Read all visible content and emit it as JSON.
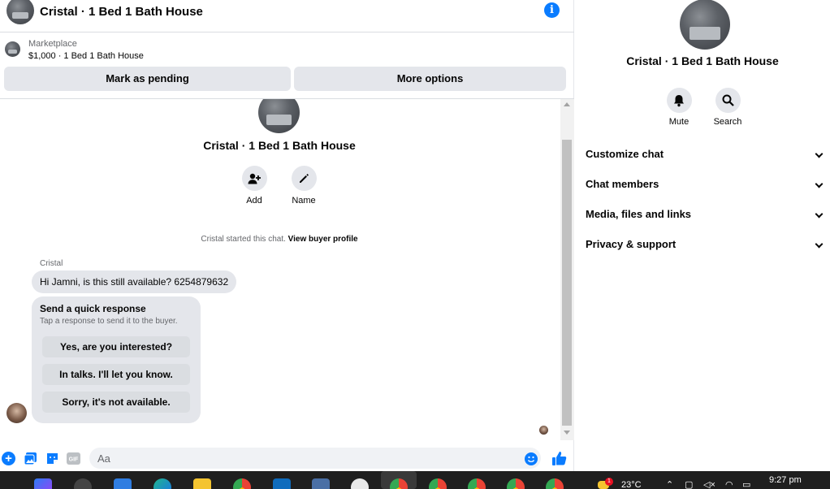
{
  "header": {
    "title": "Cristal · 1 Bed 1 Bath House"
  },
  "marketplace": {
    "label": "Marketplace",
    "item": "$1,000 · 1 Bed 1 Bath House"
  },
  "actions": {
    "mark_pending": "Mark as pending",
    "more_options": "More options"
  },
  "profile": {
    "name": "Cristal · 1 Bed 1 Bath House",
    "add_label": "Add",
    "name_label": "Name"
  },
  "chat": {
    "started_prefix": "Cristal started this chat.",
    "started_link": "View buyer profile",
    "sender": "Cristal",
    "message": "Hi Jamni, is this still available? 6254879632",
    "quick_title": "Send a quick response",
    "quick_subtitle": "Tap a response to send it to the buyer.",
    "quick_responses": [
      "Yes, are you interested?",
      "In talks. I'll let you know.",
      "Sorry, it's not available."
    ]
  },
  "composer": {
    "placeholder": "Aa"
  },
  "panel": {
    "name": "Cristal · 1 Bed 1 Bath House",
    "mute_label": "Mute",
    "search_label": "Search",
    "sections": [
      "Customize chat",
      "Chat members",
      "Media, files and links",
      "Privacy & support"
    ]
  },
  "taskbar": {
    "temperature": "23°C",
    "time": "9:27 pm",
    "notification_count": "1"
  },
  "colors": {
    "accent": "#0a7cff",
    "bubble": "#e4e6eb",
    "taskbar": "#1f1f1f"
  }
}
